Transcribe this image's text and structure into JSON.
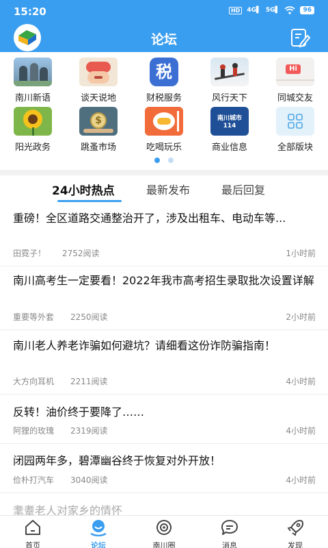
{
  "status_bar": {
    "time": "15:20",
    "network": "HD",
    "signal_4g": "4G",
    "signal_5g": "5G",
    "battery": "96"
  },
  "header": {
    "title": "论坛"
  },
  "categories": [
    {
      "label": "南川新语",
      "icon": "news-icon"
    },
    {
      "label": "谈天说地",
      "icon": "chat-icon"
    },
    {
      "label": "财税服务",
      "icon": "tax-icon",
      "icon_text": "税"
    },
    {
      "label": "风行天下",
      "icon": "travel-icon"
    },
    {
      "label": "同城交友",
      "icon": "friends-icon",
      "icon_text": "Hi"
    },
    {
      "label": "阳光政务",
      "icon": "sunflower-icon"
    },
    {
      "label": "跳蚤市场",
      "icon": "market-icon"
    },
    {
      "label": "吃喝玩乐",
      "icon": "food-icon"
    },
    {
      "label": "商业信息",
      "icon": "business-icon",
      "icon_text": "南川城市114"
    },
    {
      "label": "全部版块",
      "icon": "grid-icon"
    }
  ],
  "pager": {
    "pages": 2,
    "active": 1
  },
  "tabs": [
    {
      "label": "24小时热点",
      "active": true
    },
    {
      "label": "最新发布",
      "active": false
    },
    {
      "label": "最后回复",
      "active": false
    }
  ],
  "posts": [
    {
      "title": "重磅！全区道路交通整治开了，涉及出租车、电动车等...",
      "author": "田霓子！",
      "reads": "2752阅读",
      "time": "1小时前"
    },
    {
      "title": "南川高考生一定要看！2022年我市高考招生录取批次设置详解",
      "author": "重要等外套",
      "reads": "2250阅读",
      "time": "2小时前"
    },
    {
      "title": "南川老人养老诈骗如何避坑？请细看这份诈防骗指南！",
      "author": "大方向耳机",
      "reads": "2211阅读",
      "time": "4小时前"
    },
    {
      "title": "反转！油价终于要降了……",
      "author": "阿狸的玫瑰",
      "reads": "2319阅读",
      "time": "4小时前"
    },
    {
      "title": "闭园两年多，碧潭幽谷终于恢复对外开放！",
      "author": "俭朴打汽车",
      "reads": "3040阅读",
      "time": "4小时前"
    }
  ],
  "partial_post": {
    "title": "耄耋老人对家乡的情怀"
  },
  "bottom_nav": [
    {
      "label": "首页",
      "icon": "home-icon",
      "active": false
    },
    {
      "label": "论坛",
      "icon": "forum-icon",
      "active": true
    },
    {
      "label": "南川圈",
      "icon": "circle-icon",
      "active": false
    },
    {
      "label": "消息",
      "icon": "message-icon",
      "active": false
    },
    {
      "label": "发现",
      "icon": "rocket-icon",
      "active": false
    }
  ],
  "colors": {
    "primary": "#3a9ef0",
    "divider": "#f2f2f2",
    "meta": "#888888"
  }
}
